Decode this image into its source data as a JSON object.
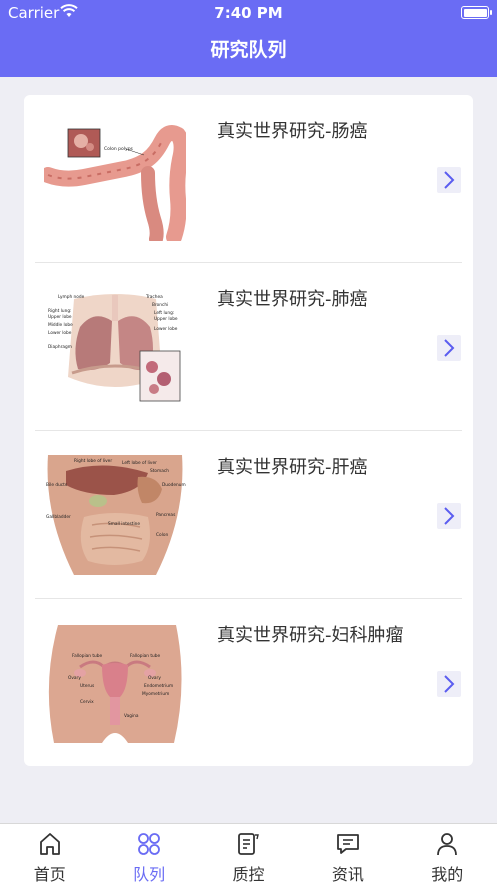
{
  "status_bar": {
    "carrier": "Carrier",
    "time": "7:40 PM"
  },
  "nav": {
    "title": "研究队列"
  },
  "studies": [
    {
      "title": "真实世界研究-肠癌",
      "image": "colon-anatomy",
      "image_labels": [
        "Colon polyps"
      ]
    },
    {
      "title": "真实世界研究-肺癌",
      "image": "lung-anatomy",
      "image_labels": [
        "Lymph node",
        "Trachea",
        "Bronchi",
        "Right lung:",
        "Upper lobe",
        "Middle lobe",
        "Lower lobe",
        "Left lung:",
        "Upper lobe",
        "Lower lobe",
        "Diaphragm"
      ]
    },
    {
      "title": "真实世界研究-肝癌",
      "image": "liver-anatomy",
      "image_labels": [
        "Right lobe of liver",
        "Left lobe of liver",
        "Stomach",
        "Bile ducts",
        "Duodenum",
        "Pancreas",
        "Gallbladder",
        "Small intestine",
        "Colon"
      ]
    },
    {
      "title": "真实世界研究-妇科肿瘤",
      "image": "female-reproductive-anatomy",
      "image_labels": [
        "Fallopian tube",
        "Fallopian tube",
        "Ovary",
        "Ovary",
        "Uterus",
        "Endometrium",
        "Myometrium",
        "Cervix",
        "Vagina"
      ]
    }
  ],
  "tabs": [
    {
      "label": "首页",
      "icon": "home-icon",
      "active": false
    },
    {
      "label": "队列",
      "icon": "clover-icon",
      "active": true
    },
    {
      "label": "质控",
      "icon": "document-edit-icon",
      "active": false
    },
    {
      "label": "资讯",
      "icon": "message-icon",
      "active": false
    },
    {
      "label": "我的",
      "icon": "person-icon",
      "active": false
    }
  ],
  "colors": {
    "accent": "#6a6cf4",
    "inactive": "#333333",
    "background": "#eeeef4"
  }
}
